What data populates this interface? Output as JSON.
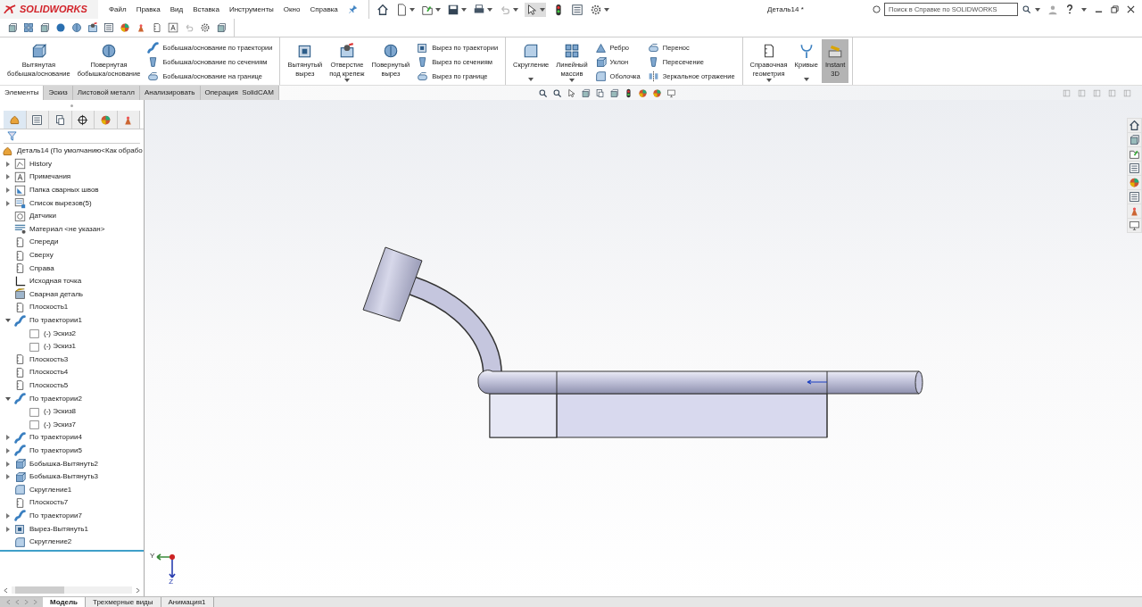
{
  "app": {
    "logo": "SOLIDWORKS",
    "menu": [
      "Файл",
      "Правка",
      "Вид",
      "Вставка",
      "Инструменты",
      "Окно",
      "Справка"
    ],
    "title": "Деталь14 *",
    "search": {
      "placeholder": "Поиск в Справке по SOLIDWORKS"
    }
  },
  "ribbon": [
    {
      "items": [
        {
          "kind": "large",
          "label": "Вытянутая\nбобышка/основание",
          "menu": false,
          "on": false
        },
        {
          "kind": "large",
          "label": "Повернутая\nбобышка/основание",
          "menu": false,
          "on": false
        },
        {
          "kind": "stack",
          "entries": [
            "Бобышка/основание по траектории",
            "Бобышка/основание по сечениям",
            "Бобышка/основание на границе"
          ]
        }
      ]
    },
    {
      "items": [
        {
          "kind": "large",
          "label": "Вытянутый\nвырез",
          "menu": false,
          "on": false
        },
        {
          "kind": "large",
          "label": "Отверстие\nпод крепеж",
          "menu": true,
          "on": false
        },
        {
          "kind": "large",
          "label": "Повернутый\nвырез",
          "menu": false,
          "on": false
        },
        {
          "kind": "stack",
          "entries": [
            "Вырез по траектории",
            "Вырез по сечениям",
            "Вырез по границе"
          ]
        }
      ]
    },
    {
      "items": [
        {
          "kind": "large",
          "label": "Скругление",
          "menu": true,
          "on": false
        },
        {
          "kind": "large",
          "label": "Линейный\nмассив",
          "menu": true,
          "on": false
        },
        {
          "kind": "stack",
          "entries": [
            "Ребро",
            "Уклон",
            "Оболочка"
          ]
        },
        {
          "kind": "stack",
          "entries": [
            "Перенос",
            "Пересечение",
            "Зеркальное отражение"
          ]
        }
      ]
    },
    {
      "items": [
        {
          "kind": "large",
          "label": "Справочная\nгеометрия",
          "menu": true,
          "on": false
        },
        {
          "kind": "large",
          "label": "Кривые",
          "menu": true,
          "on": false
        },
        {
          "kind": "large",
          "label": "Instant\n3D",
          "menu": false,
          "on": true
        }
      ]
    }
  ],
  "command_tabs": [
    {
      "label": "Элементы",
      "selected": true
    },
    {
      "label": "Эскиз",
      "selected": false
    },
    {
      "label": "Листовой металл",
      "selected": false
    },
    {
      "label": "Анализировать",
      "selected": false
    },
    {
      "label": "Операция  SolidCAM",
      "selected": false
    }
  ],
  "panel_tabs": [
    {
      "kind": "tree",
      "selected": true
    },
    {
      "kind": "properties",
      "selected": false
    },
    {
      "kind": "config",
      "selected": false
    },
    {
      "kind": "target",
      "selected": false
    },
    {
      "kind": "appearance",
      "selected": false
    },
    {
      "kind": "cam",
      "selected": false
    }
  ],
  "tree": {
    "root": "Деталь14  (По умолчанию<Как обрабо",
    "items": [
      {
        "label": "History",
        "kind": "history",
        "expanded": false
      },
      {
        "label": "Примечания",
        "kind": "notes",
        "expanded": false
      },
      {
        "label": "Папка сварных швов",
        "kind": "folder",
        "expanded": false
      },
      {
        "label": "Список вырезов(5)",
        "kind": "list",
        "expanded": false
      },
      {
        "label": "Датчики",
        "kind": "sensor"
      },
      {
        "label": "Материал <не указан>",
        "kind": "material"
      },
      {
        "label": "Спереди",
        "kind": "plane"
      },
      {
        "label": "Сверху",
        "kind": "plane"
      },
      {
        "label": "Справа",
        "kind": "plane"
      },
      {
        "label": "Исходная точка",
        "kind": "origin"
      },
      {
        "label": "Сварная деталь",
        "kind": "weld"
      },
      {
        "label": "Плоскость1",
        "kind": "plane"
      },
      {
        "label": "По траектории1",
        "kind": "sweep",
        "expanded": true,
        "children": [
          {
            "label": "(-) Эскиз2",
            "kind": "sketch"
          },
          {
            "label": "(-) Эскиз1",
            "kind": "sketch"
          }
        ]
      },
      {
        "label": "Плоскость3",
        "kind": "plane"
      },
      {
        "label": "Плоскость4",
        "kind": "plane"
      },
      {
        "label": "Плоскость5",
        "kind": "plane"
      },
      {
        "label": "По траектории2",
        "kind": "sweep",
        "expanded": true,
        "children": [
          {
            "label": "(-) Эскиз8",
            "kind": "sketch"
          },
          {
            "label": "(-) Эскиз7",
            "kind": "sketch"
          }
        ]
      },
      {
        "label": "По траектории4",
        "kind": "sweep",
        "expanded": false
      },
      {
        "label": "По траектории5",
        "kind": "sweep",
        "expanded": false
      },
      {
        "label": "Бобышка-Вытянуть2",
        "kind": "boss",
        "expanded": false
      },
      {
        "label": "Бобышка-Вытянуть3",
        "kind": "boss",
        "expanded": false
      },
      {
        "label": "Скругление1",
        "kind": "fillet"
      },
      {
        "label": "Плоскость7",
        "kind": "plane"
      },
      {
        "label": "По траектории7",
        "kind": "sweep",
        "expanded": false
      },
      {
        "label": "Вырез-Вытянуть1",
        "kind": "cut",
        "expanded": false
      },
      {
        "label": "Скругление2",
        "kind": "fillet"
      }
    ]
  },
  "triad": {
    "y_label": "Y",
    "z_label": "Z"
  },
  "bottom_tabs": [
    {
      "label": "Модель",
      "selected": true
    },
    {
      "label": "Трехмерные виды",
      "selected": false
    },
    {
      "label": "Анимация1",
      "selected": false
    }
  ]
}
